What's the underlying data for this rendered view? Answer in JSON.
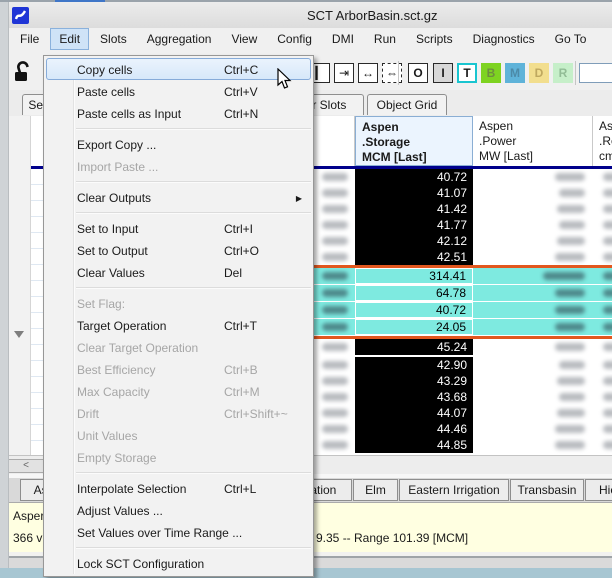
{
  "window": {
    "title": "SCT ArborBasin.sct.gz"
  },
  "menubar": {
    "items": [
      "File",
      "Edit",
      "Slots",
      "Aggregation",
      "View",
      "Config",
      "DMI",
      "Run",
      "Scripts",
      "Diagnostics",
      "Go To"
    ],
    "active": "Edit"
  },
  "toolbar": {
    "lock_icon": "open-padlock-icon",
    "sizing_icons": [
      {
        "name": "column-divider-icon",
        "glyph": "▎",
        "dashed": false
      },
      {
        "name": "expand-column-right-icon",
        "glyph": "⇥",
        "dashed": false
      },
      {
        "name": "fit-column-width-icon",
        "glyph": "↔",
        "dashed": false
      },
      {
        "name": "fit-all-columns-icon",
        "glyph": "⇔",
        "dashed": true
      }
    ],
    "flag_buttons": [
      {
        "label": "O",
        "bg": "#ffffff",
        "border": "#2a2a2a",
        "fg": "#1a1a1a",
        "active": false
      },
      {
        "label": "I",
        "bg": "#d8d8d8",
        "border": "#2a2a2a",
        "fg": "#1a1a1a",
        "active": false
      },
      {
        "label": "T",
        "bg": "#ffffff",
        "border": "#19c5d0",
        "fg": "#1a1a1a",
        "active": true
      },
      {
        "label": "B",
        "bg": "#7ed321",
        "border": "#7ed321",
        "fg": "#6d8f3e",
        "active": false
      },
      {
        "label": "M",
        "bg": "#5fb3d9",
        "border": "#5fb3d9",
        "fg": "#4c8aa8",
        "active": false
      },
      {
        "label": "D",
        "bg": "#f2de8e",
        "border": "#f2de8e",
        "fg": "#bfa85f",
        "active": false
      },
      {
        "label": "R",
        "bg": "#c6efc9",
        "border": "#c6efc9",
        "fg": "#92bd96",
        "active": false
      }
    ],
    "field_value": ""
  },
  "top_tabs": [
    {
      "label": "Seri"
    },
    {
      "label": "er Slots"
    },
    {
      "label": "Object Grid"
    }
  ],
  "edit_menu": {
    "items": [
      {
        "label": "Copy cells",
        "shortcut": "Ctrl+C",
        "highlighted": true
      },
      {
        "label": "Paste cells",
        "shortcut": "Ctrl+V"
      },
      {
        "label": "Paste cells as Input",
        "shortcut": "Ctrl+N"
      },
      {
        "type": "separator"
      },
      {
        "label": "Export Copy ..."
      },
      {
        "label": "Import Paste ...",
        "disabled": true
      },
      {
        "type": "separator"
      },
      {
        "label": "Clear Outputs",
        "submenu": true
      },
      {
        "type": "separator"
      },
      {
        "label": "Set to Input",
        "shortcut": "Ctrl+I"
      },
      {
        "label": "Set to Output",
        "shortcut": "Ctrl+O"
      },
      {
        "label": "Clear Values",
        "shortcut": "Del"
      },
      {
        "type": "separator"
      },
      {
        "label": "Set Flag:",
        "disabled": true
      },
      {
        "label": "Target Operation",
        "shortcut": "Ctrl+T"
      },
      {
        "label": "Clear Target Operation",
        "disabled": true
      },
      {
        "label": "Best Efficiency",
        "shortcut": "Ctrl+B",
        "disabled": true
      },
      {
        "label": "Max Capacity",
        "shortcut": "Ctrl+M",
        "disabled": true
      },
      {
        "label": "Drift",
        "shortcut": "Ctrl+Shift+~",
        "disabled": true
      },
      {
        "label": "Unit Values",
        "disabled": true
      },
      {
        "label": "Empty Storage",
        "disabled": true
      },
      {
        "type": "separator"
      },
      {
        "label": "Interpolate Selection",
        "shortcut": "Ctrl+L"
      },
      {
        "label": "Adjust Values ..."
      },
      {
        "label": "Set Values over Time Range ..."
      },
      {
        "type": "separator"
      },
      {
        "label": "Lock SCT Configuration"
      }
    ]
  },
  "table": {
    "columns": [
      {
        "lines": [
          "Aspen",
          ".Storage",
          "MCM [Last]"
        ],
        "selected": true
      },
      {
        "lines": [
          "Aspen",
          ".Power",
          "MW [Last]"
        ],
        "selected": false
      },
      {
        "lines": [
          "Asp",
          ".Re",
          "cms"
        ],
        "selected": false
      }
    ],
    "timestamp_column_redacted": true,
    "other_value_columns_redacted": true,
    "rows": [
      {
        "type": "data",
        "zone": "black",
        "value": "40.72"
      },
      {
        "type": "data",
        "zone": "black",
        "value": "41.07"
      },
      {
        "type": "data",
        "zone": "black",
        "value": "41.42"
      },
      {
        "type": "data",
        "zone": "black",
        "value": "41.77"
      },
      {
        "type": "data",
        "zone": "black",
        "value": "42.12"
      },
      {
        "type": "data",
        "zone": "black",
        "value": "42.51"
      },
      {
        "type": "orange-sep"
      },
      {
        "type": "data",
        "zone": "cyan",
        "value": "314.41"
      },
      {
        "type": "data",
        "zone": "cyan",
        "value": "64.78"
      },
      {
        "type": "data",
        "zone": "cyan",
        "value": "40.72"
      },
      {
        "type": "data",
        "zone": "cyan",
        "value": "24.05"
      },
      {
        "type": "orange-sep"
      },
      {
        "type": "data",
        "zone": "black",
        "value": "45.24"
      },
      {
        "type": "gap"
      },
      {
        "type": "data",
        "zone": "black",
        "value": "42.90"
      },
      {
        "type": "data",
        "zone": "black",
        "value": "43.29"
      },
      {
        "type": "data",
        "zone": "black",
        "value": "43.68"
      },
      {
        "type": "data",
        "zone": "black",
        "value": "44.07"
      },
      {
        "type": "data",
        "zone": "black",
        "value": "44.46"
      },
      {
        "type": "data",
        "zone": "black",
        "value": "44.85"
      }
    ]
  },
  "scrollbar": {
    "left_arrow": "<"
  },
  "bottom_tabs": [
    {
      "label": "Asp"
    },
    {
      "label": "gation"
    },
    {
      "label": "Elm"
    },
    {
      "label": "Eastern Irrigation"
    },
    {
      "label": "Transbasin"
    },
    {
      "label": "Hicko"
    }
  ],
  "status": {
    "line1": "Asper",
    "line2_left": "366 v",
    "line2_right": "9.35 -- Range 101.39 [MCM]"
  },
  "colors": {
    "cyan_row": "#7eeae0",
    "orange_separator": "#e2571e",
    "navy_header_line": "#00008b",
    "black_cell": "#000000",
    "status_bg": "#ffffe1",
    "menu_highlight": "#d7e8fa"
  }
}
